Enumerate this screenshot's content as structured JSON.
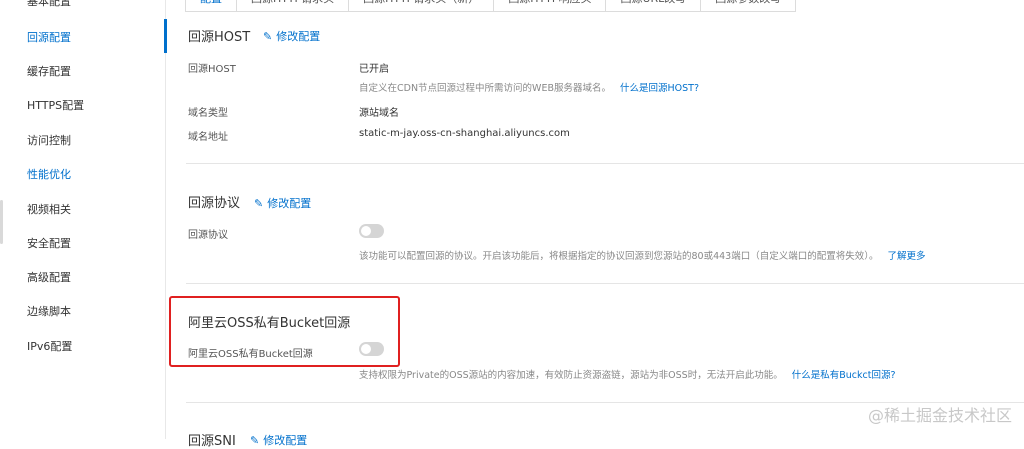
{
  "sidebar": {
    "items": [
      {
        "label": "基本配置"
      },
      {
        "label": "回源配置"
      },
      {
        "label": "缓存配置"
      },
      {
        "label": "HTTPS配置"
      },
      {
        "label": "访问控制"
      },
      {
        "label": "性能优化"
      },
      {
        "label": "视频相关"
      },
      {
        "label": "安全配置"
      },
      {
        "label": "高级配置"
      },
      {
        "label": "边缘脚本"
      },
      {
        "label": "IPv6配置"
      }
    ]
  },
  "tabs": [
    "配置",
    "回源HTTP请求头",
    "回源HTTP请求头（新）",
    "回源HTTP响应头",
    "回源URL改写",
    "回源参数改写"
  ],
  "host_section": {
    "title": "回源HOST",
    "edit": "修改配置",
    "rows": [
      {
        "label": "回源HOST",
        "value": "已开启"
      },
      {
        "label": "域名类型",
        "value": "源站域名"
      },
      {
        "label": "域名地址",
        "value": "static-m-jay.oss-cn-shanghai.aliyuncs.com"
      }
    ],
    "desc": "自定义在CDN节点回源过程中所需访问的WEB服务器域名。",
    "desc_link": "什么是回源HOST?"
  },
  "protocol_section": {
    "title": "回源协议",
    "edit": "修改配置",
    "label": "回源协议",
    "toggle_on": false,
    "desc": "该功能可以配置回源的协议。开启该功能后，将根据指定的协议回源到您源站的80或443端口（自定义端口的配置将失效）。",
    "desc_link": "了解更多"
  },
  "oss_section": {
    "title": "阿里云OSS私有Bucket回源",
    "label": "阿里云OSS私有Bucket回源",
    "toggle_on": false,
    "desc": "支持权限为Private的OSS源站的内容加速，有效防止资源盗链，源站为非OSS时，无法开启此功能。",
    "desc_link": "什么是私有Buckct回源?"
  },
  "sni_section": {
    "title": "回源SNI",
    "edit": "修改配置"
  },
  "watermark": "@稀土掘金技术社区",
  "colors": {
    "accent": "#0070cc",
    "highlight": "#e02020"
  }
}
